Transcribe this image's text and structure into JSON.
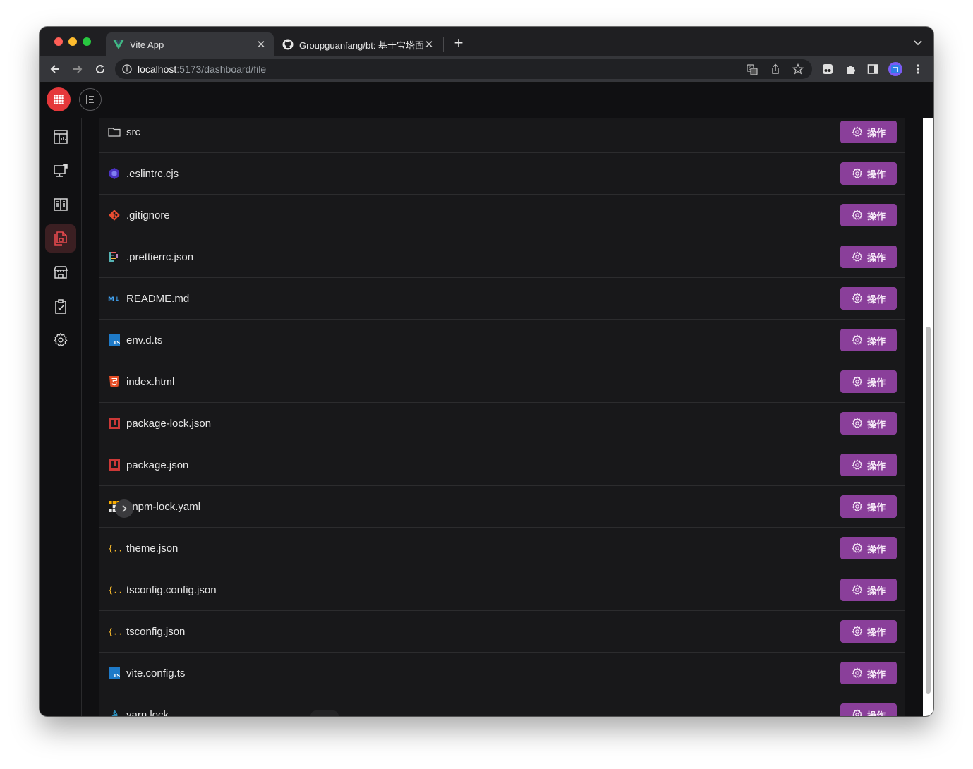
{
  "browser": {
    "tabs": [
      {
        "title": "Vite App",
        "icon": "vue-logo-icon",
        "active": true
      },
      {
        "title": "Groupguanfang/bt: 基于宝塔面板",
        "icon": "github-icon",
        "active": false
      }
    ],
    "new_tab_label": "+",
    "url_host": "localhost",
    "url_path": ":5173/dashboard/file"
  },
  "sidebar": {
    "items": [
      {
        "icon": "dashboard-icon",
        "active": false
      },
      {
        "icon": "monitor-icon",
        "active": false
      },
      {
        "icon": "book-icon",
        "active": false
      },
      {
        "icon": "files-icon",
        "active": true
      },
      {
        "icon": "store-icon",
        "active": false
      },
      {
        "icon": "clipboard-check-icon",
        "active": false
      },
      {
        "icon": "gear-icon",
        "active": false
      }
    ]
  },
  "files": [
    {
      "name": "src",
      "icon": "folder-icon"
    },
    {
      "name": ".eslintrc.cjs",
      "icon": "eslint-icon"
    },
    {
      "name": ".gitignore",
      "icon": "git-icon"
    },
    {
      "name": ".prettierrc.json",
      "icon": "prettier-icon"
    },
    {
      "name": "README.md",
      "icon": "markdown-icon"
    },
    {
      "name": "env.d.ts",
      "icon": "typescript-icon"
    },
    {
      "name": "index.html",
      "icon": "html5-icon"
    },
    {
      "name": "package-lock.json",
      "icon": "npm-icon"
    },
    {
      "name": "package.json",
      "icon": "npm-icon"
    },
    {
      "name": "pnpm-lock.yaml",
      "icon": "pnpm-icon"
    },
    {
      "name": "theme.json",
      "icon": "json-icon"
    },
    {
      "name": "tsconfig.config.json",
      "icon": "json-icon"
    },
    {
      "name": "tsconfig.json",
      "icon": "json-icon"
    },
    {
      "name": "vite.config.ts",
      "icon": "typescript-icon"
    },
    {
      "name": "yarn.lock",
      "icon": "yarn-icon"
    }
  ],
  "action_label": "操作",
  "colors": {
    "accent_purple": "#8a3f9a",
    "brand_red": "#e5383b",
    "active_nav_icon": "#e5484d"
  }
}
